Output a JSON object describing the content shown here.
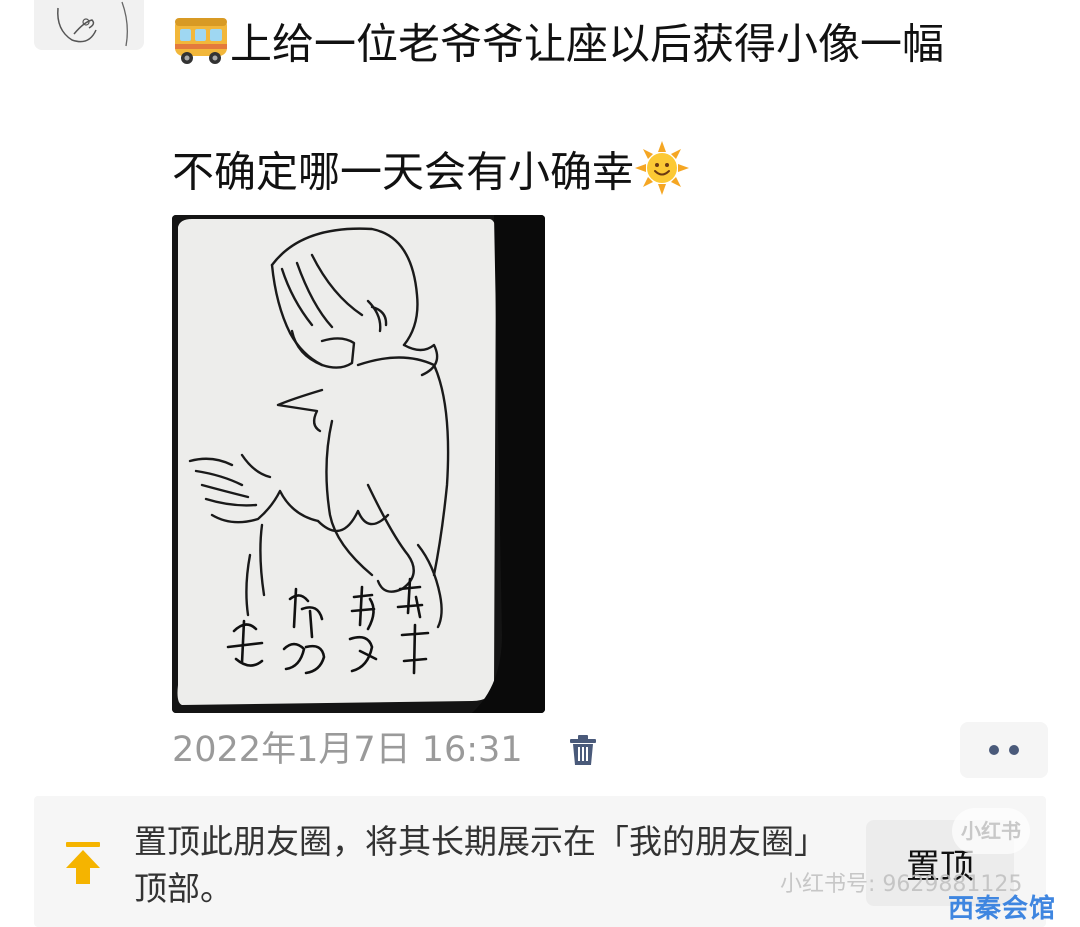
{
  "post": {
    "line1_text": "上给一位老爷爷让座以后获得小像一幅",
    "line1_emoji": "bus-emoji",
    "line2_text": "不确定哪一天会有小确幸",
    "line2_emoji": "sun-face-emoji",
    "photo_handwriting": [
      "车上",
      "孩童",
      "抓好",
      "平安"
    ]
  },
  "meta": {
    "timestamp": "2022年1月7日 16:31",
    "delete_icon": "trash-icon",
    "more_icon": "more-dots-icon"
  },
  "pin_bar": {
    "icon": "pin-top-arrow-icon",
    "text": "置顶此朋友圈，将其长期展示在「我的朋友圈」顶部。",
    "button_label": "置顶"
  },
  "watermark": {
    "badge": "小红书",
    "id_text": "小红书号: 9629881125",
    "brand": "西秦会馆"
  },
  "colors": {
    "timestamp": "#9a9a9a",
    "icon_accent": "#4a5a7a",
    "pin_arrow": "#f5b400",
    "brand": "#3f86e0"
  }
}
